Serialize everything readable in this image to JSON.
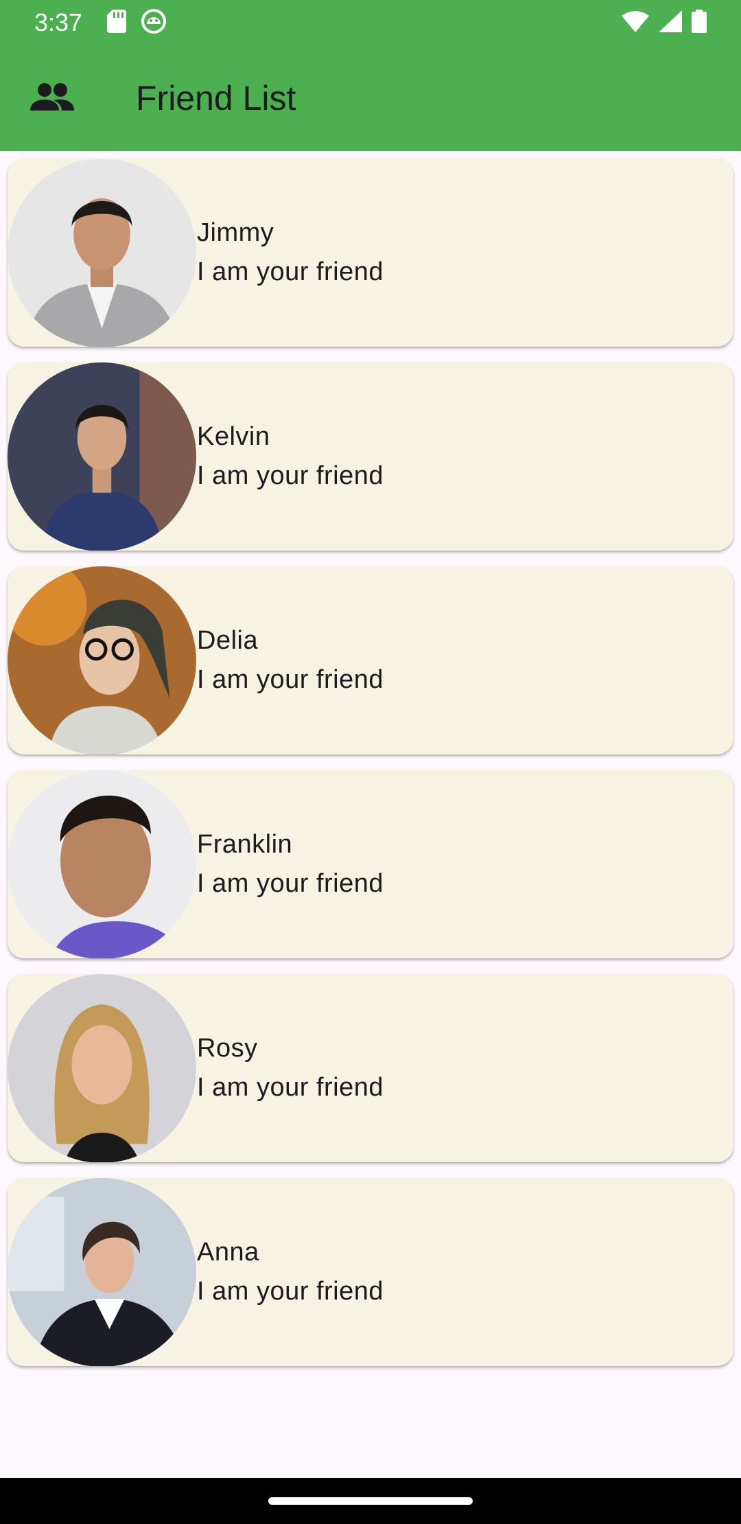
{
  "status_bar": {
    "time": "3:37",
    "icons_left": [
      "sd-card-icon",
      "android-debug-icon"
    ],
    "icons_right": [
      "wifi-icon",
      "signal-icon",
      "battery-icon"
    ]
  },
  "app_bar": {
    "icon": "people-icon",
    "title": "Friend List",
    "color": "#4caf50"
  },
  "friends": [
    {
      "name": "Jimmy",
      "subtitle": "I am your friend"
    },
    {
      "name": "Kelvin",
      "subtitle": "I am your friend"
    },
    {
      "name": "Delia",
      "subtitle": "I am your friend"
    },
    {
      "name": "Franklin",
      "subtitle": "I am your friend"
    },
    {
      "name": "Rosy",
      "subtitle": "I am your friend"
    },
    {
      "name": "Anna",
      "subtitle": "I am your friend"
    }
  ],
  "colors": {
    "card_background": "#f6f3e3",
    "page_background": "#fdf8fd"
  }
}
